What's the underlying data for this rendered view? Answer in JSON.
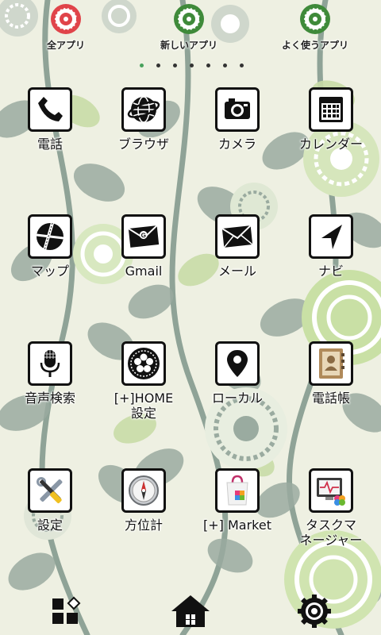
{
  "tabs": [
    {
      "label": "全アプリ",
      "color": "#e0444a"
    },
    {
      "label": "新しいアプリ",
      "color": "#3f8a3a"
    },
    {
      "label": "よく使うアプリ",
      "color": "#3f8a3a"
    }
  ],
  "page_indicator": {
    "count": 7,
    "active_index": 0,
    "active_color": "#48a15c"
  },
  "apps": [
    {
      "label": "電話",
      "icon": "phone-icon"
    },
    {
      "label": "ブラウザ",
      "icon": "globe-icon"
    },
    {
      "label": "カメラ",
      "icon": "camera-icon"
    },
    {
      "label": "カレンダー",
      "icon": "calendar-icon"
    },
    {
      "label": "マップ",
      "icon": "map-icon"
    },
    {
      "label": "Gmail",
      "icon": "gmail-envelope-icon"
    },
    {
      "label": "メール",
      "icon": "mail-envelope-icon"
    },
    {
      "label": "ナビ",
      "icon": "navigation-arrow-icon"
    },
    {
      "label": "音声検索",
      "icon": "microphone-icon"
    },
    {
      "label": "[+]HOME\n設定",
      "icon": "flower-settings-icon"
    },
    {
      "label": "ローカル",
      "icon": "location-pin-icon"
    },
    {
      "label": "電話帳",
      "icon": "contacts-book-icon"
    },
    {
      "label": "設定",
      "icon": "tools-icon"
    },
    {
      "label": "方位計",
      "icon": "compass-icon"
    },
    {
      "label": "[+] Market",
      "icon": "market-bag-icon"
    },
    {
      "label": "タスクマ\nネージャー",
      "icon": "task-manager-icon"
    }
  ],
  "dock": [
    {
      "icon": "app-drawer-icon"
    },
    {
      "icon": "home-icon"
    },
    {
      "icon": "settings-gear-icon"
    }
  ],
  "colors": {
    "background": "#eef0e2",
    "leaf": "#9aaba0",
    "leaf_light": "#c8dca8",
    "accent_green": "#48a15c"
  }
}
